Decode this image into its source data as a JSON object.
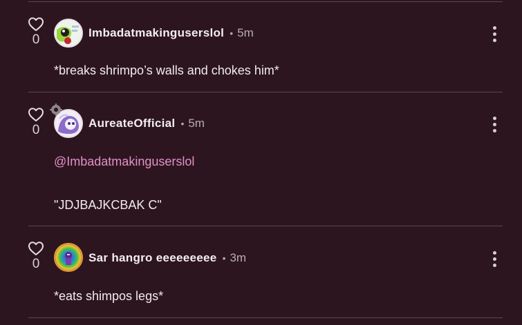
{
  "comments": [
    {
      "likes": "0",
      "username": "Imbadatmakinguserslol",
      "separator": "•",
      "time": "5m",
      "body": "*breaks shrimpo’s walls and chokes him*"
    },
    {
      "likes": "0",
      "username": "AureateOfficial",
      "separator": "•",
      "time": "5m",
      "mention": "@Imbadatmakinguserslol",
      "body": "\"JDJBAJKCBAK C\""
    },
    {
      "likes": "0",
      "username": "Sar hangro eeeeeeeee",
      "separator": "•",
      "time": "3m",
      "body": "*eats shimpos legs*"
    }
  ],
  "icons": {
    "like": "heart-outline-icon",
    "more": "more-vertical-icon",
    "badge": "gear-badge-icon"
  },
  "colors": {
    "background": "#2d1520",
    "divider": "#5a4650",
    "mention": "#e291c6",
    "text": "#f1ebee"
  }
}
